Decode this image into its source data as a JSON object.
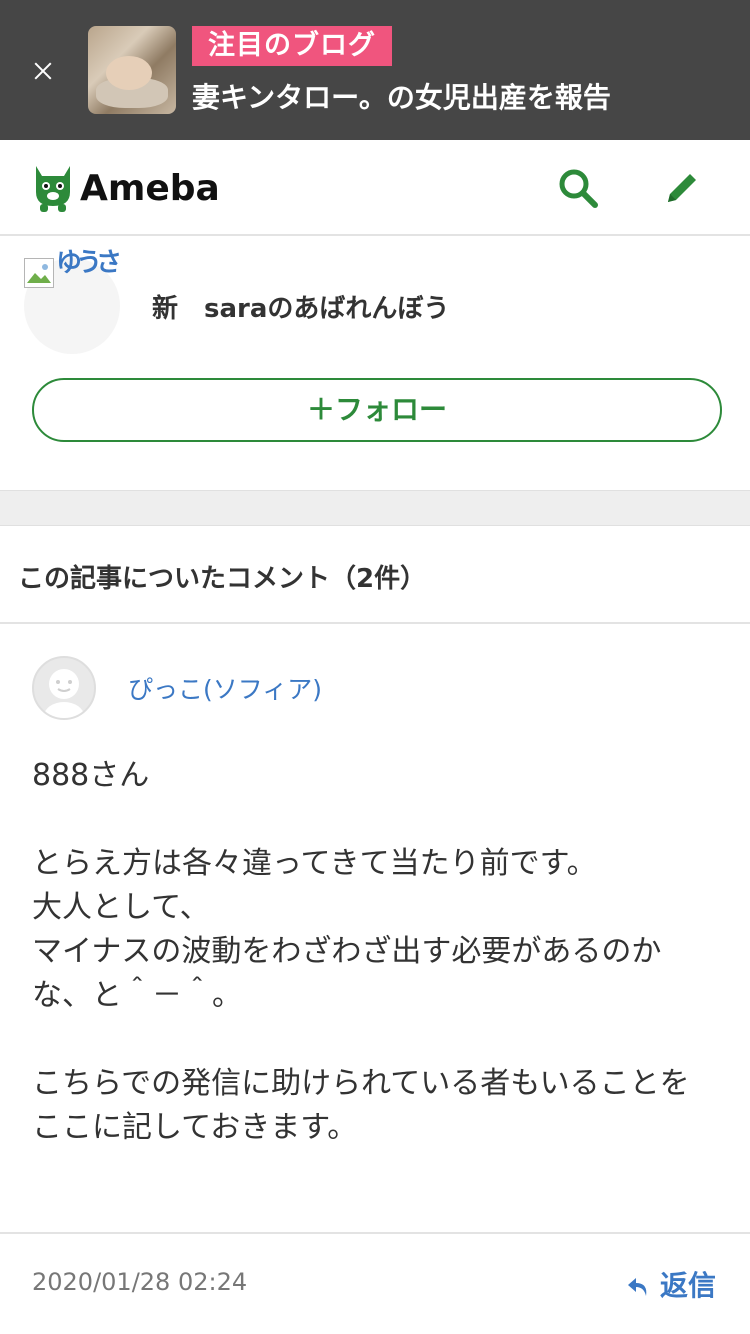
{
  "banner": {
    "tag": "注目のブログ",
    "headline": "妻キンタロー。の女児出産を報告"
  },
  "header": {
    "logo_text": "Ameba",
    "brand_color": "#2d8a3a"
  },
  "profile": {
    "avatar_alt": "ゆうさ",
    "blog_name": "新　saraのあばれんぼう",
    "follow_label": "＋フォロー"
  },
  "comments": {
    "heading": "この記事についたコメント（2件）",
    "items": [
      {
        "author": "ぴっこ(ソフィア)",
        "lines": [
          "888さん",
          "",
          "とらえ方は各々違ってきて当たり前です。",
          "大人として、",
          "マイナスの波動をわざわざ出す必要があるのかな、と＾－＾。",
          "",
          "こちらでの発信に助けられている者もいることを",
          "ここに記しておきます。"
        ],
        "timestamp": "2020/01/28 02:24",
        "reply_label": "返信"
      }
    ]
  }
}
